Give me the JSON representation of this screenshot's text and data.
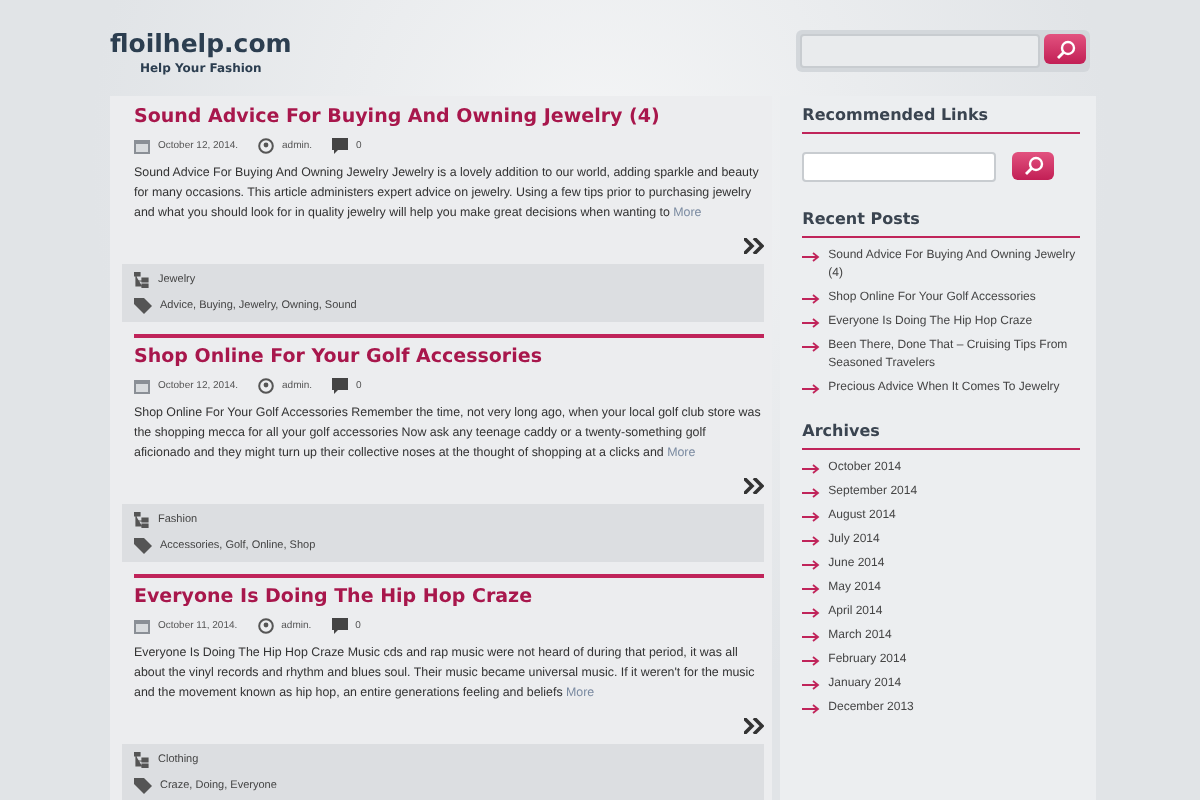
{
  "site": {
    "title": "floilhelp.com",
    "tagline": "Help Your Fashion"
  },
  "posts": [
    {
      "title": "Sound Advice For Buying And Owning Jewelry (4)",
      "date": "October 12, 2014.",
      "author": "admin.",
      "comments": "0",
      "excerpt": "Sound Advice For Buying And Owning Jewelry Jewelry is a lovely addition to our world, adding sparkle and beauty for many occasions. This article administers expert advice on jewelry. Using a few tips prior to purchasing jewelry and what you should look for in quality jewelry will help you make great decisions when wanting to",
      "more": "More",
      "category": "Jewelry",
      "tags": "Advice, Buying, Jewelry, Owning, Sound"
    },
    {
      "title": "Shop Online For Your Golf Accessories",
      "date": "October 12, 2014.",
      "author": "admin.",
      "comments": "0",
      "excerpt": "Shop Online For Your Golf Accessories Remember the time, not very long ago, when your local golf club store was the shopping mecca for all your golf accessories Now ask any teenage caddy or a twenty-something golf aficionado and they might turn up their collective noses at the thought of shopping at a clicks and",
      "more": "More",
      "category": "Fashion",
      "tags": "Accessories, Golf, Online, Shop"
    },
    {
      "title": "Everyone Is Doing The Hip Hop Craze",
      "date": "October 11, 2014.",
      "author": "admin.",
      "comments": "0",
      "excerpt": "Everyone Is Doing The Hip Hop Craze Music cds and rap music were not heard of during that period, it was all about the vinyl records and rhythm and blues soul. Their music became universal music. If it weren't for the music and the movement known as hip hop, an entire generations feeling and beliefs",
      "more": "More",
      "category": "Clothing",
      "tags": "Craze, Doing, Everyone"
    }
  ],
  "sidebar": {
    "recommended": {
      "heading": "Recommended Links"
    },
    "recent": {
      "heading": "Recent Posts",
      "items": [
        "Sound Advice For Buying And Owning Jewelry (4)",
        "Shop Online For Your Golf Accessories",
        "Everyone Is Doing The Hip Hop Craze",
        "Been There, Done That – Cruising Tips From Seasoned Travelers",
        "Precious Advice When It Comes To Jewelry"
      ]
    },
    "archives": {
      "heading": "Archives",
      "items": [
        "October 2014",
        "September 2014",
        "August 2014",
        "July 2014",
        "June 2014",
        "May 2014",
        "April 2014",
        "March 2014",
        "February 2014",
        "January 2014",
        "December 2013"
      ]
    }
  }
}
